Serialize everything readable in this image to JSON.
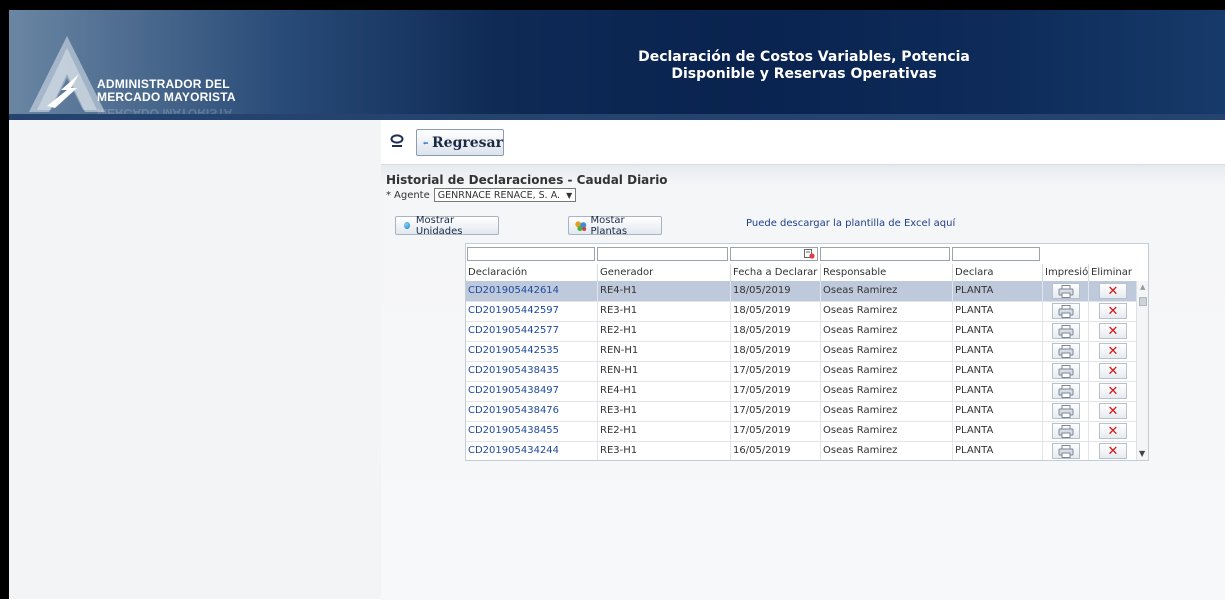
{
  "header": {
    "logo_line1": "ADMINISTRADOR DEL",
    "logo_line2": "MERCADO MAYORISTA",
    "title_line1": "Declaración de Costos Variables, Potencia",
    "title_line2": "Disponible y Reservas Operativas"
  },
  "toolbar": {
    "back_label": "Regresar"
  },
  "panel": {
    "title": "Historial de Declaraciones - Caudal Diario",
    "agent_label": "Agente",
    "agent_required_marker": "*",
    "agent_value": "GENRNACE RENACE, S. A.",
    "btn_units": "Mostrar Unidades",
    "btn_plants": "Mostar Plantas",
    "excel_link": "Puede descargar la plantilla de Excel aquí"
  },
  "table": {
    "columns": [
      "Declaración",
      "Generador",
      "Fecha a Declarar",
      "Responsable",
      "Declara",
      "Impresión",
      "Eliminar"
    ],
    "rows": [
      {
        "declaracion": "CD201905442614",
        "generador": "RE4-H1",
        "fecha": "18/05/2019",
        "responsable": "Oseas Ramirez",
        "declara": "PLANTA"
      },
      {
        "declaracion": "CD201905442597",
        "generador": "RE3-H1",
        "fecha": "18/05/2019",
        "responsable": "Oseas Ramirez",
        "declara": "PLANTA"
      },
      {
        "declaracion": "CD201905442577",
        "generador": "RE2-H1",
        "fecha": "18/05/2019",
        "responsable": "Oseas Ramirez",
        "declara": "PLANTA"
      },
      {
        "declaracion": "CD201905442535",
        "generador": "REN-H1",
        "fecha": "18/05/2019",
        "responsable": "Oseas Ramirez",
        "declara": "PLANTA"
      },
      {
        "declaracion": "CD201905438435",
        "generador": "REN-H1",
        "fecha": "17/05/2019",
        "responsable": "Oseas Ramirez",
        "declara": "PLANTA"
      },
      {
        "declaracion": "CD201905438497",
        "generador": "RE4-H1",
        "fecha": "17/05/2019",
        "responsable": "Oseas Ramirez",
        "declara": "PLANTA"
      },
      {
        "declaracion": "CD201905438476",
        "generador": "RE3-H1",
        "fecha": "17/05/2019",
        "responsable": "Oseas Ramirez",
        "declara": "PLANTA"
      },
      {
        "declaracion": "CD201905438455",
        "generador": "RE2-H1",
        "fecha": "17/05/2019",
        "responsable": "Oseas Ramirez",
        "declara": "PLANTA"
      },
      {
        "declaracion": "CD201905434244",
        "generador": "RE3-H1",
        "fecha": "16/05/2019",
        "responsable": "Oseas Ramirez",
        "declara": "PLANTA"
      }
    ],
    "selected_row": 0
  },
  "colors": {
    "header_dark": "#0a2350",
    "link": "#1f4aa0",
    "selected_row": "#bfc9dc",
    "delete": "#dd1111"
  },
  "icons": {
    "search": "magnifier-icon",
    "back": "left-arrow-icon",
    "print": "printer-icon",
    "delete": "x-icon",
    "filter_date": "calendar-clear-icon"
  }
}
